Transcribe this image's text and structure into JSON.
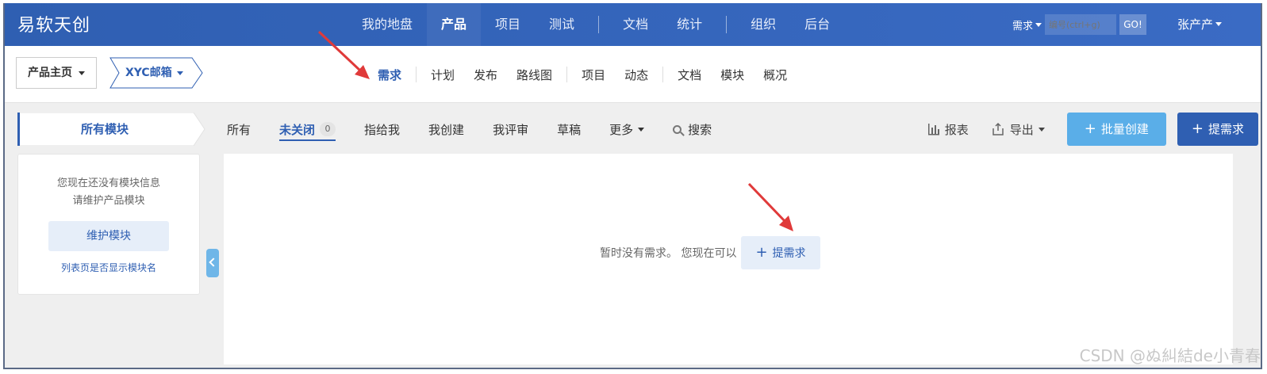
{
  "brand": "易软天创",
  "main_nav": [
    "我的地盘",
    "产品",
    "项目",
    "测试",
    "文档",
    "统计",
    "组织",
    "后台"
  ],
  "main_nav_active": "产品",
  "search": {
    "type": "需求",
    "placeholder": "编号(ctrl+g)",
    "go": "GO!"
  },
  "user": "张产产",
  "breadcrumb": {
    "home": "产品主页",
    "product": "XYC邮箱"
  },
  "sub_nav": [
    "需求",
    "计划",
    "发布",
    "路线图",
    "项目",
    "动态",
    "文档",
    "模块",
    "概况"
  ],
  "sub_nav_active": "需求",
  "module_tab": "所有模块",
  "module_panel": {
    "line1": "您现在还没有模块信息",
    "line2": "请维护产品模块",
    "button": "维护模块",
    "link": "列表页是否显示模块名"
  },
  "filters": [
    "所有",
    "未关闭",
    "指给我",
    "我创建",
    "我评审",
    "草稿",
    "更多",
    "搜索"
  ],
  "unclosed_count": "0",
  "actions": {
    "report": "报表",
    "export": "导出",
    "batch_create": "批量创建",
    "create": "提需求"
  },
  "empty": {
    "text": "暂时没有需求。 您现在可以",
    "button": "提需求"
  },
  "watermark": "CSDN @ぬ糾結de小青春",
  "colors": {
    "nav_blue": "#2f5fb2",
    "light_blue": "#5aaee8",
    "arrow_red": "#e03a3a"
  }
}
